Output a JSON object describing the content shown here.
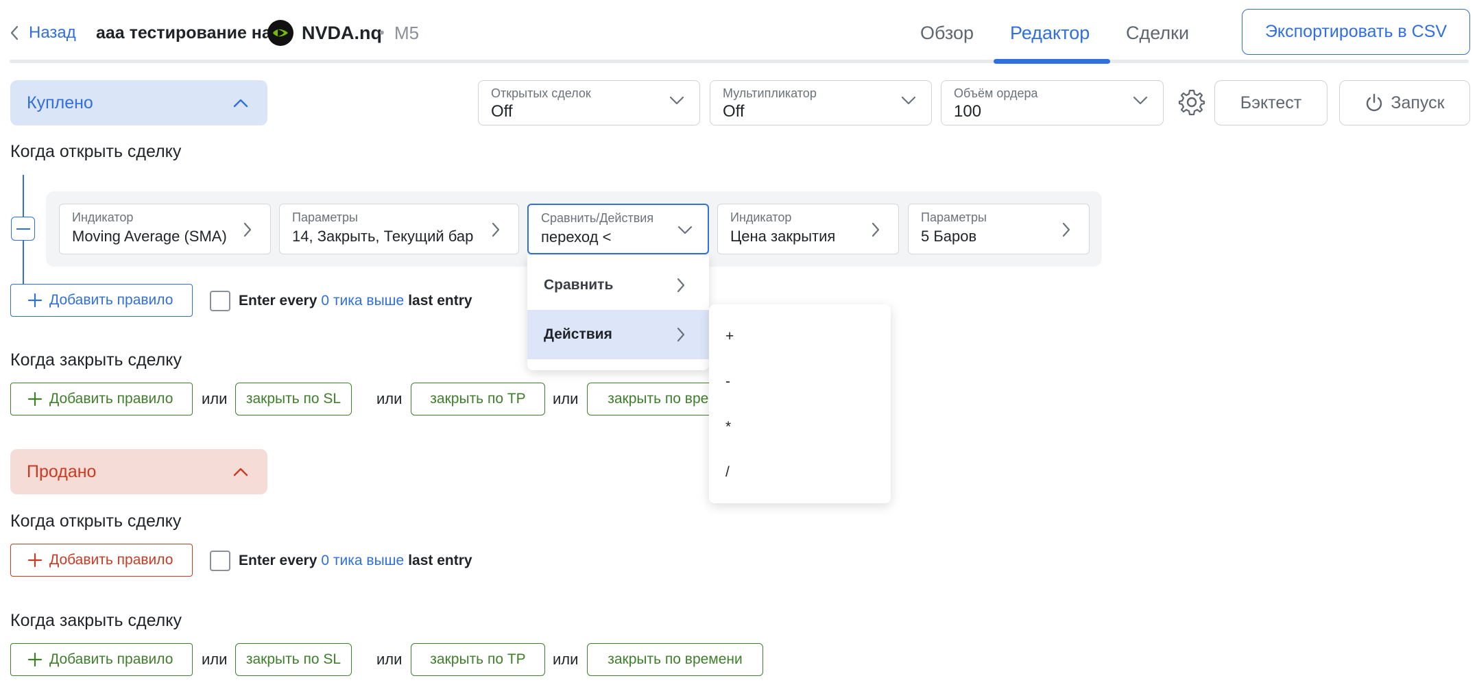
{
  "header": {
    "back_label": "Назад",
    "title": "ааа тестирование на",
    "ticker": "NVDA.nq",
    "separator": "•",
    "timeframe": "M5",
    "tabs": [
      {
        "label": "Обзор",
        "active": false
      },
      {
        "label": "Редактор",
        "active": true
      },
      {
        "label": "Сделки",
        "active": false
      }
    ],
    "export_label": "Экспортировать в CSV"
  },
  "toolbar": {
    "open_trades": {
      "label": "Открытых сделок",
      "value": "Off"
    },
    "multiplier": {
      "label": "Мультипликатор",
      "value": "Off"
    },
    "order_volume": {
      "label": "Объём ордера",
      "value": "100"
    },
    "backtest_label": "Бэктест",
    "launch_label": "Запуск"
  },
  "buy": {
    "title": "Куплено",
    "open_heading": "Когда открыть сделку",
    "rule": {
      "indicator1": {
        "label": "Индикатор",
        "value": "Moving Average (SMA)"
      },
      "params1": {
        "label": "Параметры",
        "value": "14, Закрыть, Текущий бар"
      },
      "compare": {
        "label": "Сравнить/Действия",
        "value": "переход <"
      },
      "indicator2": {
        "label": "Индикатор",
        "value": "Цена закрытия"
      },
      "params2": {
        "label": "Параметры",
        "value": "5 Баров"
      }
    },
    "add_rule_label": "Добавить правило",
    "enter_every": {
      "pre": "Enter every",
      "link": "0 тика выше",
      "post": "last entry"
    },
    "close_heading": "Когда закрыть сделку",
    "close_row": {
      "add_rule_label": "Добавить правило",
      "or_label": "или",
      "sl_label": "закрыть по SL",
      "tp_label": "закрыть по TP",
      "time_label": "закрыть по времени"
    }
  },
  "sell": {
    "title": "Продано",
    "open_heading": "Когда открыть сделку",
    "add_rule_label": "Добавить правило",
    "enter_every": {
      "pre": "Enter every",
      "link": "0 тика выше",
      "post": "last entry"
    },
    "close_heading": "Когда закрыть сделку",
    "close_row": {
      "add_rule_label": "Добавить правило",
      "or_label": "или",
      "sl_label": "закрыть по SL",
      "tp_label": "закрыть по TP",
      "time_label": "закрыть по времени"
    }
  },
  "compare_menu": {
    "items": [
      {
        "label": "Сравнить",
        "highlighted": false
      },
      {
        "label": "Действия",
        "highlighted": true
      }
    ]
  },
  "actions_menu": {
    "items": [
      "+",
      "-",
      "*",
      "/"
    ]
  },
  "colors": {
    "accent": "#2f6fe0",
    "buy_bg": "#dbe5f8",
    "sell_bg": "#f6dcd7",
    "sell_text": "#cc3a22",
    "close_green": "#3d7f2a"
  }
}
